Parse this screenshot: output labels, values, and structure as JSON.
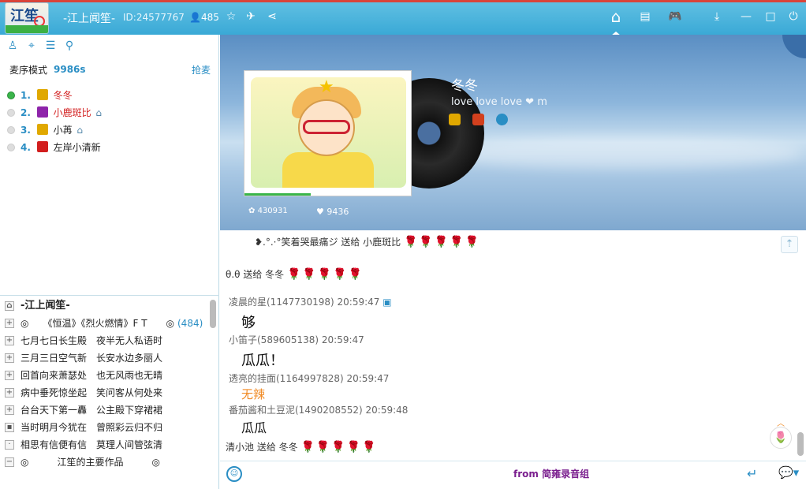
{
  "titlebar": {
    "logo_text": "江笙",
    "room_name": "-江上闻笙-",
    "room_id": "ID:24577767",
    "user_count": "485",
    "icons": [
      "star-icon",
      "plane-icon",
      "share-icon",
      "home-icon",
      "list-icon",
      "gamepad-icon",
      "download-icon",
      "minimize-icon",
      "maximize-icon",
      "power-icon"
    ]
  },
  "left": {
    "tools": [
      "user-icon",
      "location-icon",
      "notes-icon",
      "search-icon"
    ],
    "mode_label": "麦序模式",
    "mode_time": "9986s",
    "grab_label": "抢麦",
    "queue": [
      {
        "num": "1.",
        "name": "冬冬",
        "active": true,
        "name_color": "#d21e1e",
        "badge_color": "#e0a800",
        "house": false
      },
      {
        "num": "2.",
        "name": "小鹿斑比",
        "active": false,
        "name_color": "#d21e1e",
        "badge_color": "#8e24aa",
        "house": true
      },
      {
        "num": "3.",
        "name": "小苒",
        "active": false,
        "name_color": "#222222",
        "badge_color": "#e0a800",
        "house": true
      },
      {
        "num": "4.",
        "name": "左岸小清新",
        "active": false,
        "name_color": "#222222",
        "badge_color": "#d21e1e",
        "house": false
      }
    ],
    "channels": [
      {
        "icon": "⌂",
        "text": "-江上闻笙-",
        "head": true
      },
      {
        "icon": "+",
        "text": "◎　　《恒温》《烈火燃情》F T　　◎",
        "count": "(484)"
      },
      {
        "icon": "+",
        "text": "七月七日长生殿　夜半无人私语时"
      },
      {
        "icon": "+",
        "text": "三月三日空气新　长安水边多丽人"
      },
      {
        "icon": "+",
        "text": "回首向来萧瑟处　也无风雨也无晴"
      },
      {
        "icon": "+",
        "text": "病中垂死惊坐起　笑问客从何处来"
      },
      {
        "icon": "+",
        "text": "台台天下第一轟　公主殿下穿裙裙"
      },
      {
        "icon": "▪",
        "text": "当时明月今犹在　曾照彩云归不归"
      },
      {
        "icon": "·",
        "text": "相思有信便有信　莫理人间管弦清"
      },
      {
        "icon": "−",
        "text": "◎　　　江笙的主要作品　　　◎"
      }
    ]
  },
  "hero": {
    "song_title": "冬冬",
    "song_sub": "love love love ❤ m",
    "stat_likes": "430931",
    "stat_hearts": "9436"
  },
  "chat": {
    "gift1_text": "❥.°.·°笑着哭最痛ジ 送给 小鹿斑比",
    "gift2_text": "θ.θ 送给 冬冬",
    "m1_meta": "凌晨的星(1147730198) 20:59:47",
    "m1_text": "够",
    "m2_meta": "小笛子(589605138) 20:59:47",
    "m2_text": "瓜瓜！",
    "m3_meta": "透亮的挂面(1164997828) 20:59:47",
    "m3_text": "无辣",
    "m4_meta": "番茄酱和土豆泥(1490208552) 20:59:48",
    "m4_text": "瓜瓜",
    "gift3_text": "清小池 送给 冬冬"
  },
  "bottom": {
    "from_text": "from 简雍录音组"
  },
  "colors": {
    "accent": "#2a8ec4",
    "title_bar": "#4db4dd",
    "rose": "#d21e1e",
    "orange": "#f08a24"
  }
}
